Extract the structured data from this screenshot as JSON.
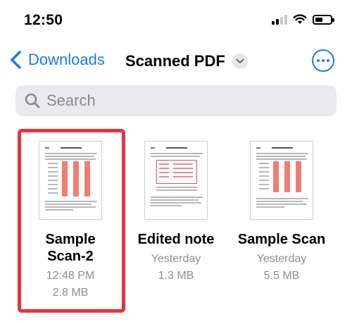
{
  "status_bar": {
    "time": "12:50",
    "icons": [
      "signal-icon",
      "wifi-icon",
      "battery-icon"
    ]
  },
  "nav": {
    "back_label": "Downloads",
    "title": "Scanned PDF",
    "more_icon": "ellipsis-circle-icon"
  },
  "search": {
    "placeholder": "Search"
  },
  "files": [
    {
      "name_line1": "Sample",
      "name_line2": "Scan-2",
      "date": "12:48 PM",
      "size": "2.8 MB",
      "selected": true
    },
    {
      "name_line1": "Edited note",
      "date": "Yesterday",
      "size": "1.3 MB",
      "selected": false
    },
    {
      "name_line1": "Sample Scan",
      "date": "Yesterday",
      "size": "5.5 MB",
      "selected": false
    }
  ],
  "colors": {
    "accent": "#1a7cf0",
    "selection": "#e8323a",
    "search_bg": "#e9e9ee",
    "secondary_text": "#8e8e93"
  }
}
